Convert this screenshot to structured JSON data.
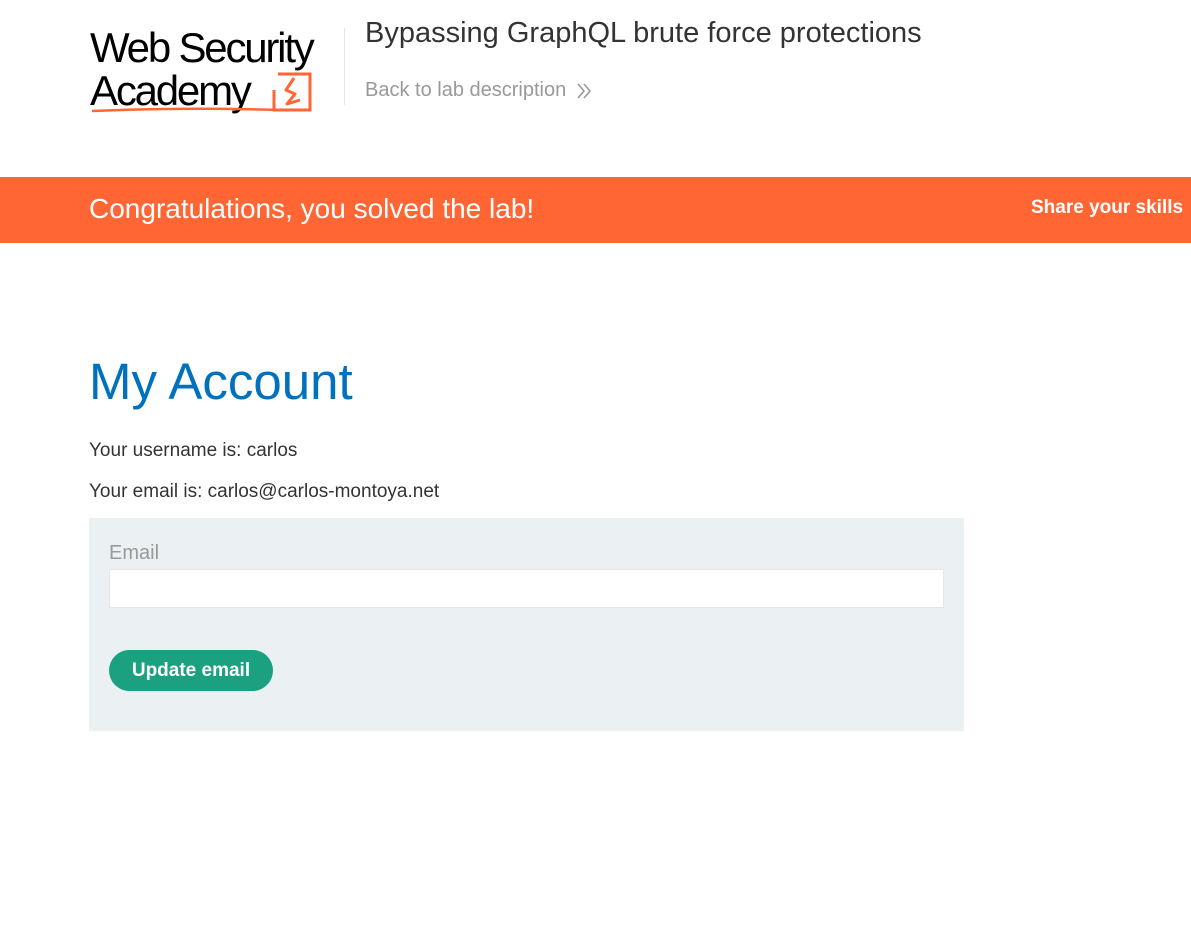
{
  "header": {
    "logo": {
      "line1": "Web Security",
      "line2": "Academy"
    },
    "lab_title": "Bypassing GraphQL brute force protections",
    "back_link": "Back to lab description"
  },
  "banner": {
    "message": "Congratulations, you solved the lab!",
    "share": "Share your skills"
  },
  "account": {
    "title": "My Account",
    "username_line": "Your username is: carlos",
    "email_line": "Your email is: carlos@carlos-montoya.net"
  },
  "form": {
    "email_label": "Email",
    "email_value": "",
    "update_button": "Update email"
  },
  "colors": {
    "brand_orange": "#ff6633",
    "title_blue": "#0071bc",
    "button_green": "#1ba080",
    "panel_background": "#ebf0f2"
  },
  "icons": {
    "logo_mark": "lightning-bolt-icon",
    "back_link": "double-chevron-right-icon"
  }
}
